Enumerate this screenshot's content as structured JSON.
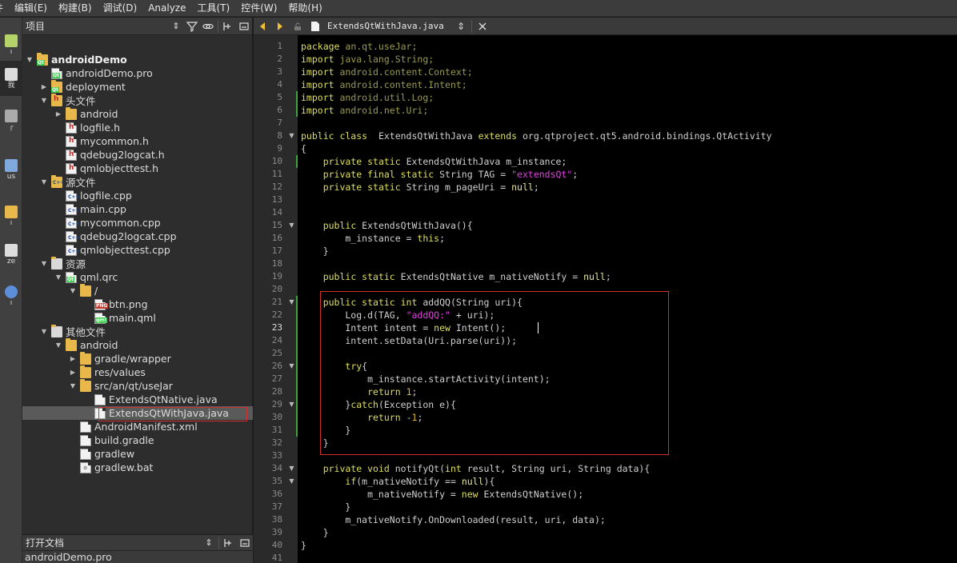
{
  "menu": [
    "件",
    "编辑(E)",
    "构建(B)",
    "调试(D)",
    "Analyze",
    "工具(T)",
    "控件(W)",
    "帮助(H)"
  ],
  "modes": [
    {
      "label": "ı",
      "icon": "welcome-icon"
    },
    {
      "label": "我",
      "icon": "edit-icon",
      "active": true
    },
    {
      "label": "┌",
      "icon": "design-icon"
    },
    {
      "label": "us",
      "icon": "debug-icon"
    },
    {
      "label": "ı",
      "icon": "projects-icon"
    },
    {
      "label": "ze",
      "icon": "analyze-icon"
    },
    {
      "label": "ı",
      "icon": "help-icon"
    }
  ],
  "project_panel": {
    "title": "项目"
  },
  "tree": [
    {
      "label": "androidDemo",
      "depth": 0,
      "arrow": "down",
      "icon": "qt-project",
      "bold": true
    },
    {
      "label": "androidDemo.pro",
      "depth": 1,
      "arrow": "",
      "icon": "pro"
    },
    {
      "label": "deployment",
      "depth": 1,
      "arrow": "right",
      "icon": "qt-folder"
    },
    {
      "label": "头文件",
      "depth": 1,
      "arrow": "down",
      "icon": "h-folder"
    },
    {
      "label": "android",
      "depth": 2,
      "arrow": "right",
      "icon": "folder"
    },
    {
      "label": "logfile.h",
      "depth": 2,
      "arrow": "",
      "icon": "h"
    },
    {
      "label": "mycommon.h",
      "depth": 2,
      "arrow": "",
      "icon": "h"
    },
    {
      "label": "qdebug2logcat.h",
      "depth": 2,
      "arrow": "",
      "icon": "h"
    },
    {
      "label": "qmlobjecttest.h",
      "depth": 2,
      "arrow": "",
      "icon": "h"
    },
    {
      "label": "源文件",
      "depth": 1,
      "arrow": "down",
      "icon": "cpp-folder"
    },
    {
      "label": "logfile.cpp",
      "depth": 2,
      "arrow": "",
      "icon": "cpp"
    },
    {
      "label": "main.cpp",
      "depth": 2,
      "arrow": "",
      "icon": "cpp"
    },
    {
      "label": "mycommon.cpp",
      "depth": 2,
      "arrow": "",
      "icon": "cpp"
    },
    {
      "label": "qdebug2logcat.cpp",
      "depth": 2,
      "arrow": "",
      "icon": "cpp"
    },
    {
      "label": "qmlobjecttest.cpp",
      "depth": 2,
      "arrow": "",
      "icon": "cpp"
    },
    {
      "label": "资源",
      "depth": 1,
      "arrow": "down",
      "icon": "res-folder"
    },
    {
      "label": "qml.qrc",
      "depth": 2,
      "arrow": "down",
      "icon": "qrc"
    },
    {
      "label": "/",
      "depth": 3,
      "arrow": "down",
      "icon": "folder"
    },
    {
      "label": "btn.png",
      "depth": 4,
      "arrow": "",
      "icon": "png"
    },
    {
      "label": "main.qml",
      "depth": 4,
      "arrow": "",
      "icon": "qml"
    },
    {
      "label": "其他文件",
      "depth": 1,
      "arrow": "down",
      "icon": "other-folder"
    },
    {
      "label": "android",
      "depth": 2,
      "arrow": "down",
      "icon": "folder"
    },
    {
      "label": "gradle/wrapper",
      "depth": 3,
      "arrow": "right",
      "icon": "folder"
    },
    {
      "label": "res/values",
      "depth": 3,
      "arrow": "right",
      "icon": "folder"
    },
    {
      "label": "src/an/qt/useJar",
      "depth": 3,
      "arrow": "down",
      "icon": "folder"
    },
    {
      "label": "ExtendsQtNative.java",
      "depth": 4,
      "arrow": "",
      "icon": "file"
    },
    {
      "label": "ExtendsQtWithJava.java",
      "depth": 4,
      "arrow": "",
      "icon": "file",
      "selected": true
    },
    {
      "label": "AndroidManifest.xml",
      "depth": 3,
      "arrow": "",
      "icon": "file"
    },
    {
      "label": "build.gradle",
      "depth": 3,
      "arrow": "",
      "icon": "file"
    },
    {
      "label": "gradlew",
      "depth": 3,
      "arrow": "",
      "icon": "file"
    },
    {
      "label": "gradlew.bat",
      "depth": 3,
      "arrow": "",
      "icon": "bat"
    }
  ],
  "open_docs": {
    "title": "打开文档",
    "items": [
      "androidDemo.pro"
    ]
  },
  "editor": {
    "file_name": "ExtendsQtWithJava.java",
    "current_line": 23,
    "folds": [
      8,
      15,
      21,
      26,
      29,
      34,
      35
    ],
    "changed": [
      5,
      6,
      10,
      21,
      22,
      23,
      24,
      25,
      26,
      27,
      28,
      29,
      30,
      31
    ],
    "lines": [
      [
        [
          "kw",
          "package"
        ],
        [
          "pk",
          " an.qt.useJar;"
        ]
      ],
      [
        [
          "kw",
          "import"
        ],
        [
          "pk",
          " java.lang.String;"
        ]
      ],
      [
        [
          "kw",
          "import"
        ],
        [
          "pk",
          " android.content.Context;"
        ]
      ],
      [
        [
          "kw",
          "import"
        ],
        [
          "pk",
          " android.content.Intent;"
        ]
      ],
      [
        [
          "kw",
          "import"
        ],
        [
          "pk",
          " android.util.Log;"
        ]
      ],
      [
        [
          "kw",
          "import"
        ],
        [
          "pk",
          " android.net.Uri;"
        ]
      ],
      [],
      [
        [
          "kw",
          "public class"
        ],
        [
          "",
          "  ExtendsQtWithJava "
        ],
        [
          "kw",
          "extends"
        ],
        [
          "",
          " org.qtproject.qt5.android.bindings.QtActivity"
        ]
      ],
      [
        [
          "",
          "{"
        ]
      ],
      [
        [
          "",
          "    "
        ],
        [
          "kw",
          "private static"
        ],
        [
          "",
          " ExtendsQtWithJava m_instance;"
        ]
      ],
      [
        [
          "",
          "    "
        ],
        [
          "kw",
          "private final static"
        ],
        [
          "",
          " String TAG = "
        ],
        [
          "str",
          "\"extendsQt\""
        ],
        [
          "",
          ";"
        ]
      ],
      [
        [
          "",
          "    "
        ],
        [
          "kw",
          "private static"
        ],
        [
          "",
          " String m_pageUri = "
        ],
        [
          "nul",
          "null"
        ],
        [
          "",
          ";"
        ]
      ],
      [],
      [],
      [
        [
          "",
          "    "
        ],
        [
          "kw",
          "public"
        ],
        [
          "",
          " ExtendsQtWithJava(){"
        ]
      ],
      [
        [
          "",
          "        m_instance = "
        ],
        [
          "kw",
          "this"
        ],
        [
          "",
          ";"
        ]
      ],
      [
        [
          "",
          "    }"
        ]
      ],
      [],
      [
        [
          "",
          "    "
        ],
        [
          "kw",
          "public static"
        ],
        [
          "",
          " ExtendsQtNative m_nativeNotify = "
        ],
        [
          "nul",
          "null"
        ],
        [
          "",
          ";"
        ]
      ],
      [],
      [
        [
          "",
          "    "
        ],
        [
          "kw",
          "public static int"
        ],
        [
          "",
          " addQQ(String uri){"
        ]
      ],
      [
        [
          "",
          "        Log.d(TAG, "
        ],
        [
          "str",
          "\"addQQ:\""
        ],
        [
          "",
          " + uri);"
        ]
      ],
      [
        [
          "",
          "        Intent intent = "
        ],
        [
          "kw",
          "new"
        ],
        [
          "",
          " Intent();"
        ]
      ],
      [
        [
          "",
          "        intent.setData(Uri.parse(uri));"
        ]
      ],
      [],
      [
        [
          "",
          "        "
        ],
        [
          "kw",
          "try"
        ],
        [
          "",
          "{"
        ]
      ],
      [
        [
          "",
          "            m_instance.startActivity(intent);"
        ]
      ],
      [
        [
          "",
          "            "
        ],
        [
          "kw",
          "return"
        ],
        [
          " "
        ],
        [
          "num",
          "1"
        ],
        [
          "",
          ";"
        ]
      ],
      [
        [
          "",
          "        }"
        ],
        [
          "kw",
          "catch"
        ],
        [
          "",
          "(Exception e){"
        ]
      ],
      [
        [
          "",
          "            "
        ],
        [
          "kw",
          "return"
        ],
        [
          "",
          " -"
        ],
        [
          "num",
          "1"
        ],
        [
          "",
          ";"
        ]
      ],
      [
        [
          "",
          "        }"
        ]
      ],
      [
        [
          "",
          "    }"
        ]
      ],
      [],
      [
        [
          "",
          "    "
        ],
        [
          "kw",
          "private void"
        ],
        [
          "",
          " notifyQt("
        ],
        [
          "kw",
          "int"
        ],
        [
          "",
          " result, String uri, String data){"
        ]
      ],
      [
        [
          "",
          "        "
        ],
        [
          "kw",
          "if"
        ],
        [
          "",
          "(m_nativeNotify == "
        ],
        [
          "nul",
          "null"
        ],
        [
          "",
          "){"
        ]
      ],
      [
        [
          "",
          "            m_nativeNotify = "
        ],
        [
          "kw",
          "new"
        ],
        [
          "",
          " ExtendsQtNative();"
        ]
      ],
      [
        [
          "",
          "        }"
        ]
      ],
      [
        [
          "",
          "        m_nativeNotify.OnDownloaded(result, uri, data);"
        ]
      ],
      [
        [
          "",
          "    }"
        ]
      ],
      [
        [
          "",
          "}"
        ]
      ],
      []
    ]
  }
}
